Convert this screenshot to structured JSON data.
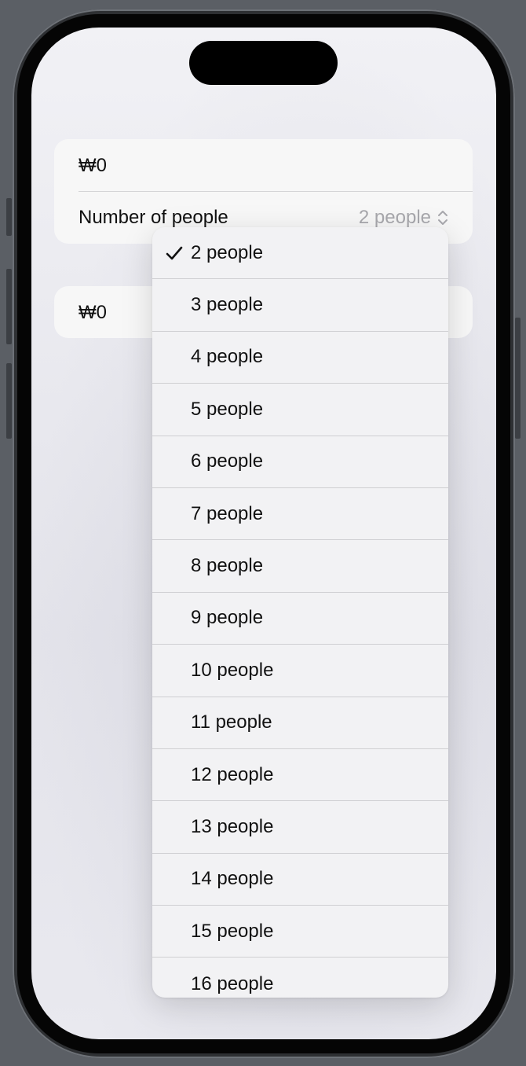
{
  "form": {
    "amount_top": "₩0",
    "people_label": "Number of people",
    "people_value": "2 people",
    "amount_bottom": "₩0"
  },
  "picker": {
    "selected_index": 0,
    "options": [
      "2 people",
      "3 people",
      "4 people",
      "5 people",
      "6 people",
      "7 people",
      "8 people",
      "9 people",
      "10 people",
      "11 people",
      "12 people",
      "13 people",
      "14 people",
      "15 people",
      "16 people"
    ]
  },
  "icons": {
    "check": "checkmark-icon",
    "chevron": "chevron-up-down-icon"
  }
}
